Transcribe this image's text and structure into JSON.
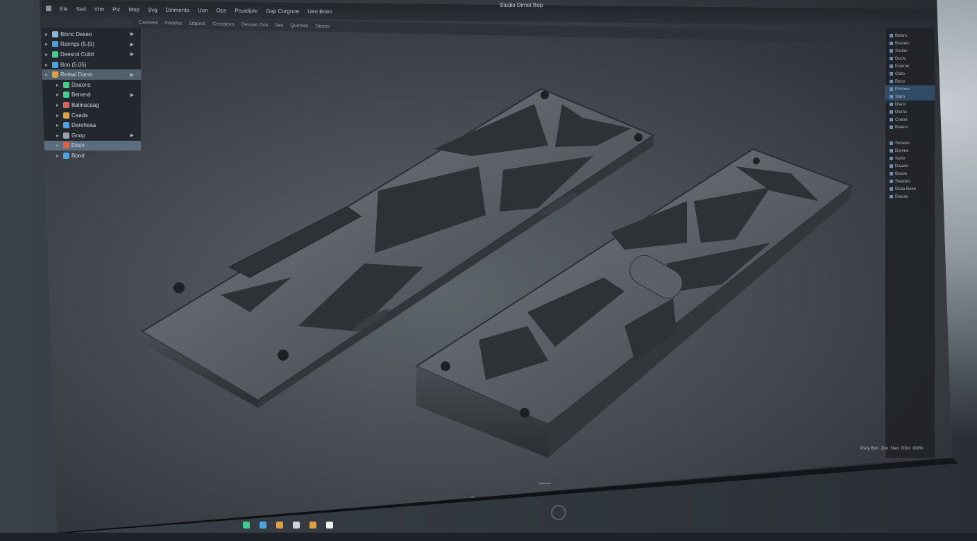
{
  "window": {
    "app_title": "Studio Dimet Bop"
  },
  "menu": {
    "items": [
      "Ele",
      "Sed",
      "Vrm",
      "Pic",
      "Mop",
      "Svg",
      "Dinmento",
      "Uon",
      "Ops",
      "Ptsadiple"
    ],
    "right_items": [
      "Gap Corgnoe",
      "Ueo Boen"
    ]
  },
  "toolbar": {
    "items": [
      "Cannees",
      "Daddes",
      "Stapers",
      "Cncsserrs",
      "Devoso Oos",
      "Ses",
      "Quinnes",
      "Deoeo"
    ]
  },
  "tree": {
    "items": [
      {
        "label": "Blonc Deseo",
        "color": "#8fb3d9"
      },
      {
        "label": "Ranngs (5.(5)",
        "color": "#4aa3df"
      },
      {
        "label": "Deesrol Coldt",
        "color": "#3ecf8e"
      },
      {
        "label": "Boo (5.05)",
        "color": "#4aa3df"
      },
      {
        "label": "Reteal Darsn",
        "color": "#e0a040"
      },
      {
        "label": "Daaons",
        "color": "#3ecf8e"
      },
      {
        "label": "Benend",
        "color": "#3ecf8e"
      },
      {
        "label": "Balinacaag",
        "color": "#e06060"
      },
      {
        "label": "Caada",
        "color": "#e0a040"
      },
      {
        "label": "Dereheaa",
        "color": "#4aa3df"
      },
      {
        "label": "Gnop",
        "color": "#9aa3ad"
      },
      {
        "label": "Dasn",
        "color": "#e06040"
      },
      {
        "label": "Bpod",
        "color": "#4aa3df"
      }
    ]
  },
  "right_panel": {
    "items": [
      "Bolam",
      "Boaneo",
      "Sretoo",
      "Doctu",
      "Eoleme",
      "Clato",
      "Baoo",
      "Ponneo",
      "Stam",
      "Dlaoo",
      "Dlomc",
      "Coana",
      "Blaiem",
      "Sooeoe",
      "Donmo",
      "Sodo",
      "Daaem",
      "Boaoo",
      "Slaadeo",
      "Doao Boeo",
      "Dlaoao"
    ]
  },
  "status": {
    "items": [
      "Psoy Bon",
      "Zoo",
      "Deo",
      "DDo",
      "100%"
    ]
  },
  "dock": {
    "colors": [
      "#d0d4d8",
      "#4aa3df",
      "#4aa3df",
      "#e0a040",
      "#d0d4d8",
      "#e8d080"
    ]
  },
  "taskbar": {
    "colors": [
      "#3ecf8e",
      "#4aa3df",
      "#e0a040",
      "#d0d4d8",
      "#e0a040",
      "#f0f0f0"
    ]
  }
}
